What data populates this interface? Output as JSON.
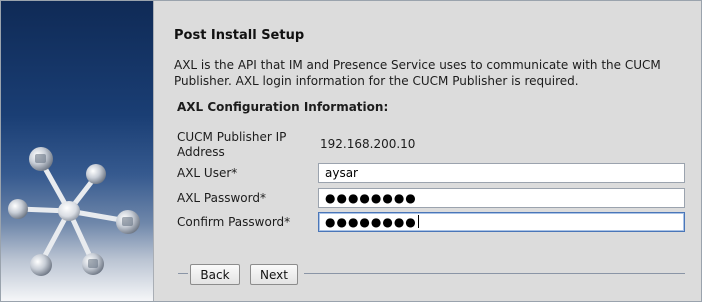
{
  "page": {
    "title": "Post Install Setup",
    "description": "AXL is the API that IM and Presence Service uses to communicate with the CUCM Publisher. AXL login information for the CUCM Publisher is required."
  },
  "section": {
    "heading": "AXL Configuration Information:"
  },
  "fields": {
    "publisher_ip": {
      "label_line1": "CUCM Publisher IP",
      "label_line2": "Address",
      "value": "192.168.200.10"
    },
    "axl_user": {
      "label": "AXL User*",
      "value": "aysar"
    },
    "axl_password": {
      "label": "AXL Password*",
      "masked_value": "●●●●●●●●"
    },
    "confirm_password": {
      "label": "Confirm Password*",
      "masked_value": "●●●●●●●●"
    }
  },
  "buttons": {
    "back": "Back",
    "next": "Next"
  },
  "colors": {
    "panel_background": "#dcdcdc",
    "art_top": "#0f2a56",
    "focus_border": "#4a76b8"
  },
  "icons": {
    "art": "network-hub-illustration"
  }
}
